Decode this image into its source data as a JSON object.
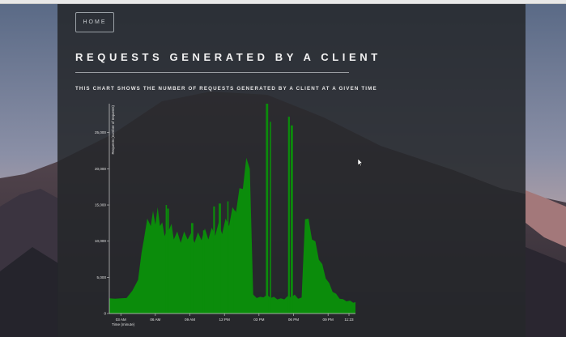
{
  "page": {
    "home_button": "HOME",
    "title": "REQUESTS GENERATED BY A CLIENT",
    "subtitle": "THIS CHART SHOWS THE NUMBER OF REQUESTS GENERATED BY A CLIENT AT A GIVEN TIME"
  },
  "colors": {
    "panel": "#24262a",
    "area": "#0b8c0b",
    "text": "#f2f2f2"
  },
  "chart_data": {
    "type": "area",
    "title": "",
    "xlabel": "Time (minute)",
    "ylabel": "Requests (number of requests)",
    "x_tick_labels": [
      "03 AM",
      "06 AM",
      "09 AM",
      "12 PM",
      "03 PM",
      "06 PM",
      "09 PM",
      "11:23"
    ],
    "y_tick_labels": [
      "0",
      "5,000",
      "10,000",
      "15,000",
      "20,000",
      "25,000"
    ],
    "ylim": [
      0,
      29000
    ],
    "xlim_hours": [
      2.0,
      23.38
    ],
    "series": [
      {
        "values_hours": [
          2.0,
          2.5,
          3.0,
          3.5,
          4.0,
          4.5,
          4.8,
          5.0,
          5.3,
          5.6,
          5.8,
          6.0,
          6.2,
          6.4,
          6.6,
          6.8,
          7.0,
          7.2,
          7.4,
          7.6,
          7.9,
          8.2,
          8.5,
          8.8,
          9.1,
          9.4,
          9.7,
          10.0,
          10.3,
          10.6,
          10.9,
          11.2,
          11.5,
          11.8,
          12.1,
          12.4,
          12.7,
          13.0,
          13.3,
          13.6,
          13.9,
          14.2,
          14.5,
          14.8,
          15.1,
          15.4,
          15.7,
          16.0,
          16.3,
          16.6,
          16.9,
          17.2,
          17.5,
          17.8,
          18.1,
          18.4,
          18.7,
          19.0,
          19.3,
          19.6,
          19.9,
          20.2,
          20.5,
          20.8,
          21.1,
          21.4,
          21.7,
          22.0,
          22.3,
          22.6,
          22.9,
          23.2,
          23.38
        ],
        "values": [
          2000,
          2200,
          2000,
          2300,
          3000,
          5000,
          8000,
          11000,
          12500,
          13000,
          13500,
          13200,
          14000,
          13000,
          12000,
          11500,
          11000,
          12500,
          11800,
          11000,
          10800,
          10500,
          10800,
          11000,
          10600,
          10500,
          10700,
          10900,
          11200,
          11000,
          11300,
          11600,
          12000,
          11800,
          12500,
          13000,
          14000,
          15000,
          16500,
          18500,
          20500,
          21500,
          2500,
          2300,
          2200,
          2400,
          2500,
          2300,
          2200,
          2100,
          2000,
          2100,
          2300,
          2400,
          2500,
          2200,
          2100,
          14000,
          12500,
          11000,
          9500,
          8000,
          6500,
          5200,
          4000,
          3200,
          2600,
          2200,
          1900,
          1800,
          1700,
          1600,
          1500
        ]
      }
    ],
    "spikes_hours": [
      [
        6.95,
        15000
      ],
      [
        7.1,
        14500
      ],
      [
        9.2,
        12500
      ],
      [
        10.2,
        11500
      ],
      [
        11.1,
        14800
      ],
      [
        11.6,
        15200
      ],
      [
        12.3,
        15500
      ],
      [
        12.9,
        14200
      ],
      [
        15.7,
        29000
      ],
      [
        16.0,
        26500
      ],
      [
        17.6,
        27200
      ],
      [
        17.85,
        26000
      ]
    ],
    "grid": false,
    "legend": "none"
  }
}
